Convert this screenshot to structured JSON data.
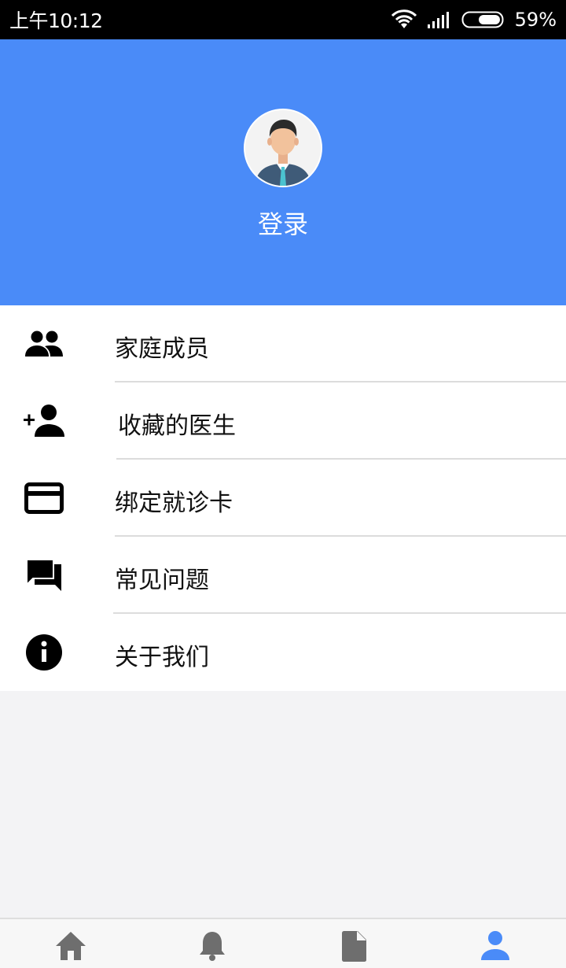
{
  "status_bar": {
    "time": "上午10:12",
    "battery_percent": "59%",
    "icons": [
      "wifi-icon",
      "signal-icon",
      "battery-icon"
    ]
  },
  "profile": {
    "login_label": "登录",
    "avatar_icon": "user-avatar",
    "header_color": "#4a8bf8"
  },
  "menu": {
    "items": [
      {
        "label": "家庭成员",
        "icon": "group-icon"
      },
      {
        "label": "收藏的医生",
        "icon": "add-person-icon"
      },
      {
        "label": "绑定就诊卡",
        "icon": "credit-card-icon"
      },
      {
        "label": "常见问题",
        "icon": "chat-icon"
      },
      {
        "label": "关于我们",
        "icon": "info-icon"
      }
    ]
  },
  "bottom_nav": {
    "tabs": [
      {
        "icon": "home-icon",
        "active": false
      },
      {
        "icon": "bell-icon",
        "active": false
      },
      {
        "icon": "document-icon",
        "active": false
      },
      {
        "icon": "person-icon",
        "active": true
      }
    ],
    "active_color": "#4a8bf8",
    "inactive_color": "#6e6e6e"
  }
}
